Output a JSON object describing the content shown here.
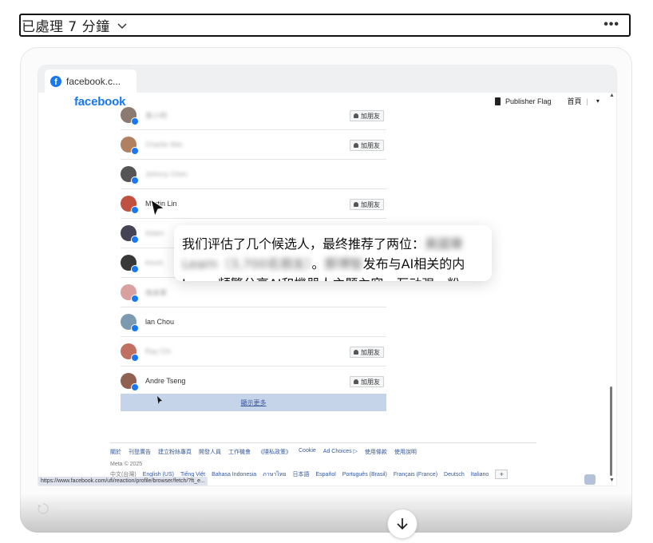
{
  "status": {
    "text": "已處理 7 分鐘",
    "more": "•••"
  },
  "browser": {
    "tab_title": "facebook.c...",
    "logo": "facebook",
    "header": {
      "publisher": "Publisher Flag",
      "home": "首頁",
      "sep": "|",
      "caret": "▾"
    }
  },
  "friends": [
    {
      "name": "黃小明",
      "blur": true,
      "button": true,
      "color": "#8a7a70"
    },
    {
      "name": "Charlie Wei",
      "blur": true,
      "button": true,
      "color": "#b08060"
    },
    {
      "name": "Johnny Chen",
      "blur": true,
      "button": false,
      "color": "#555"
    },
    {
      "name": "Martin Lin",
      "blur": false,
      "button": true,
      "color": "#c05040"
    },
    {
      "name": "Adam",
      "blur": true,
      "button": false,
      "color": "#445"
    },
    {
      "name": "Kevin",
      "blur": true,
      "button": false,
      "color": "#383838"
    },
    {
      "name": "陳美華",
      "blur": true,
      "button": false,
      "color": "#d9a0a0"
    },
    {
      "name": "lan Chou",
      "blur": false,
      "button": false,
      "color": "#7a9ab0"
    },
    {
      "name": "Ray Chi",
      "blur": true,
      "button": true,
      "color": "#c07060"
    },
    {
      "name": "Andre Tseng",
      "blur": false,
      "button": true,
      "color": "#906050"
    }
  ],
  "add_label": "加朋友",
  "show_more": "顯示更多",
  "footer_links": [
    "關於",
    "刊登廣告",
    "建立粉絲專頁",
    "開發人員",
    "工作機會",
    "《隱私政策》",
    "Cookie",
    "Ad Choices ▷",
    "使用條款",
    "使用說明"
  ],
  "copyright": "Meta © 2025",
  "languages": [
    "中文(台灣)",
    "English (US)",
    "Tiếng Việt",
    "Bahasa Indonesia",
    "ภาษาไทย",
    "日本語",
    "Español",
    "Português (Brasil)",
    "Français (France)",
    "Deutsch",
    "Italiano"
  ],
  "lang_plus": "+",
  "status_url": "https://www.facebook.com/ufi/reaction/profile/browser/fetch/?ft_e...",
  "caption": {
    "l1a": "我们评估了几个候选人，最终推荐了两位：",
    "l1b": "黃國華",
    "l2a": "Learn（3,700名朋友）",
    "l2b": "。",
    "l2c": "鄭博智",
    "l2d": "发布与AI相关的内",
    "l3": "Learn頻繁分享AI和機器人主題內容，互动强，粉"
  }
}
